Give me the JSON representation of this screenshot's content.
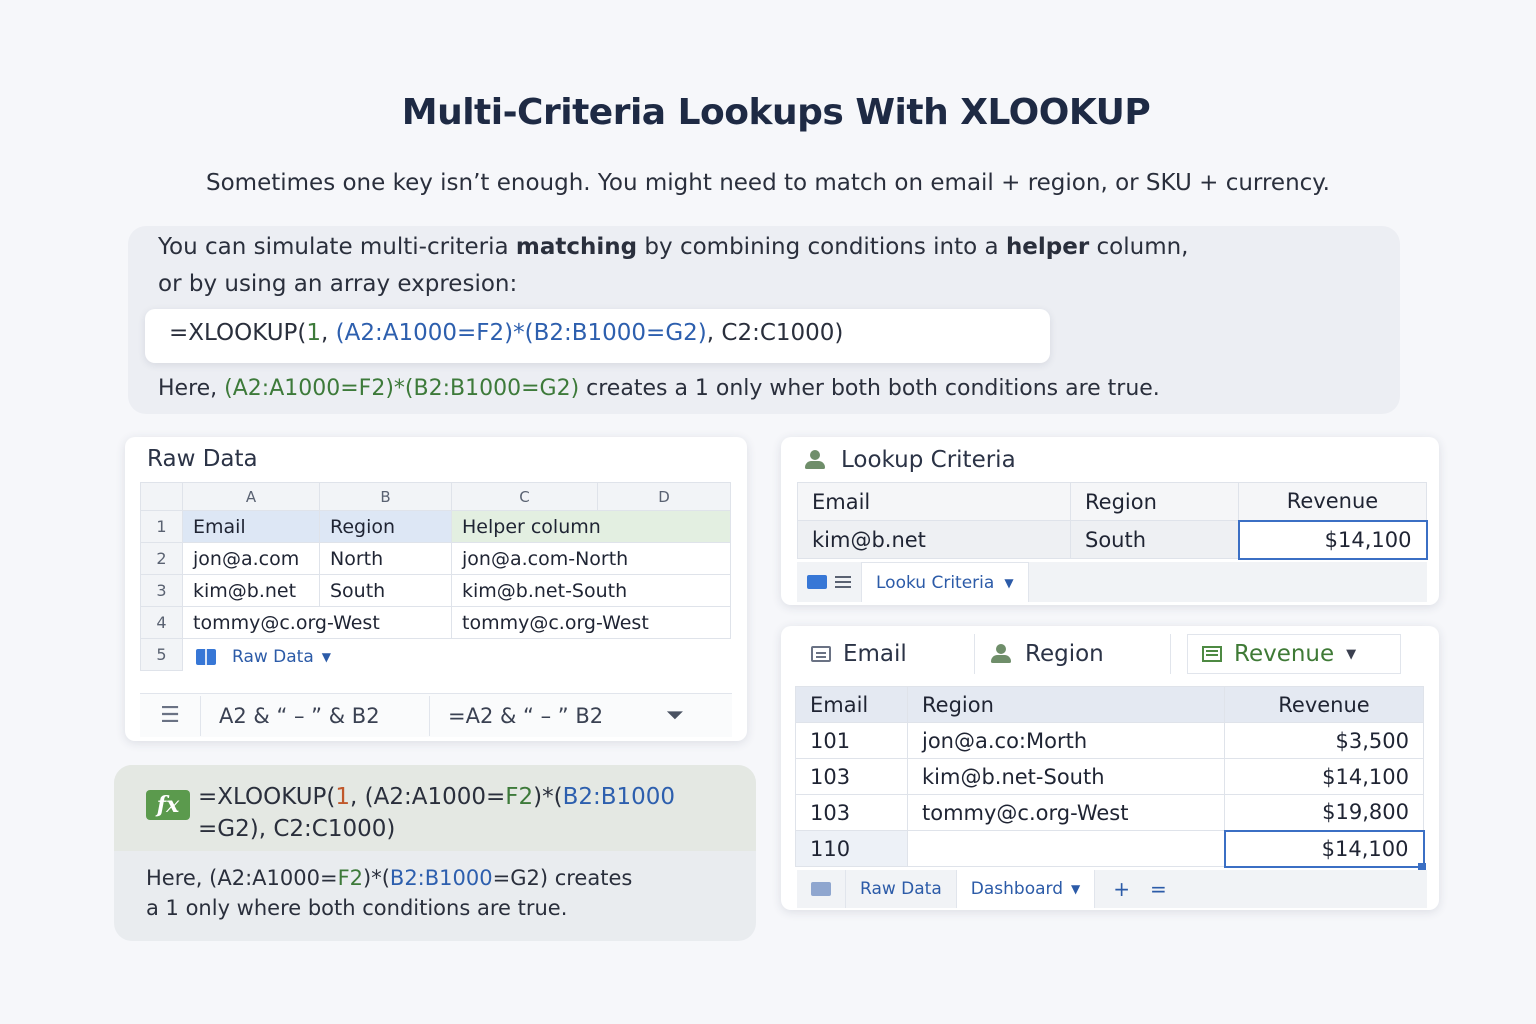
{
  "title": "Multi-Criteria Lookups With XLOOKUP",
  "intro": "Sometimes one key isn’t enough. You might need to match on email + region, or SKU + currency.",
  "explain": {
    "line1_a": "You can simulate multi-criteria ",
    "line1_b": "matching",
    "line1_c": " by combining conditions into a ",
    "line1_d": "helper",
    "line1_e": " column,",
    "line2": "or by using an array expresion:",
    "formula_prefix": "=XLOOKUP(",
    "formula_one": "1",
    "formula_mid": ", ",
    "formula_cond": "(A2:A1000=F2)*(B2:B1000=G2)",
    "formula_tail": ", C2:C1000)",
    "here_prefix": "Here, ",
    "here_cond": "(A2:A1000=F2)*(B2:B1000=G2)",
    "here_tail": "  creates a 1 only wher both both conditions are true."
  },
  "raw_data": {
    "title": "Raw Data",
    "columns": [
      "A",
      "B",
      "C",
      "D"
    ],
    "row_numbers": [
      "1",
      "2",
      "3",
      "4",
      "5"
    ],
    "header": [
      "Email",
      "Region",
      "Helper column"
    ],
    "rows": [
      [
        "jon@a.com",
        "North",
        "jon@a.com-North"
      ],
      [
        "kim@b.net",
        "South",
        "kim@b.net-South"
      ],
      [
        "tommy@c.org-West",
        "",
        "tommy@c.org-West"
      ]
    ],
    "sheet_tab": "Raw Data",
    "formula_bar_left": "A2  &  “ – ”  & B2",
    "formula_bar_right": "=A2 & “ – ”  B2"
  },
  "fx": {
    "icon": "fx",
    "line1_a": "=XLOOKUP(",
    "line1_one": "1",
    "line1_b": ", (A2:A1000=",
    "line1_f2": "F2",
    "line1_c": ")*(",
    "line1_d": "B2:B1000",
    "line2": "=G2), C2:C1000)",
    "note1_a": "Here, (A2:A1000=",
    "note1_f2": "F2",
    "note1_b": ")*(",
    "note1_c": "B2:B1000",
    "note1_d": "=G2) creates",
    "note2": "a 1 only where both conditions are true."
  },
  "lookup_criteria": {
    "title": "Lookup Criteria",
    "headers": [
      "Email",
      "Region",
      "Revenue"
    ],
    "values": [
      "kim@b.net",
      "South",
      "$14,100"
    ],
    "tab_label": "Looku Criteria"
  },
  "dashboard": {
    "head": [
      "Email",
      "Region",
      "Revenue"
    ],
    "columns": [
      "Email",
      "Region",
      "Revenue"
    ],
    "rows": [
      [
        "101",
        "jon@a.co:Morth",
        "$3,500"
      ],
      [
        "103",
        "kim@b.net-South",
        "$14,100"
      ],
      [
        "103",
        "tommy@c.org-West",
        "$19,800"
      ],
      [
        "110",
        "",
        "$14,100"
      ]
    ],
    "tabs": [
      "Raw Data",
      "Dashboard"
    ],
    "add_label": "+",
    "menu_label": "="
  },
  "colors": {
    "accent_blue": "#2d5fae",
    "accent_green": "#3d7a3a",
    "selection": "#3b6fc4"
  }
}
